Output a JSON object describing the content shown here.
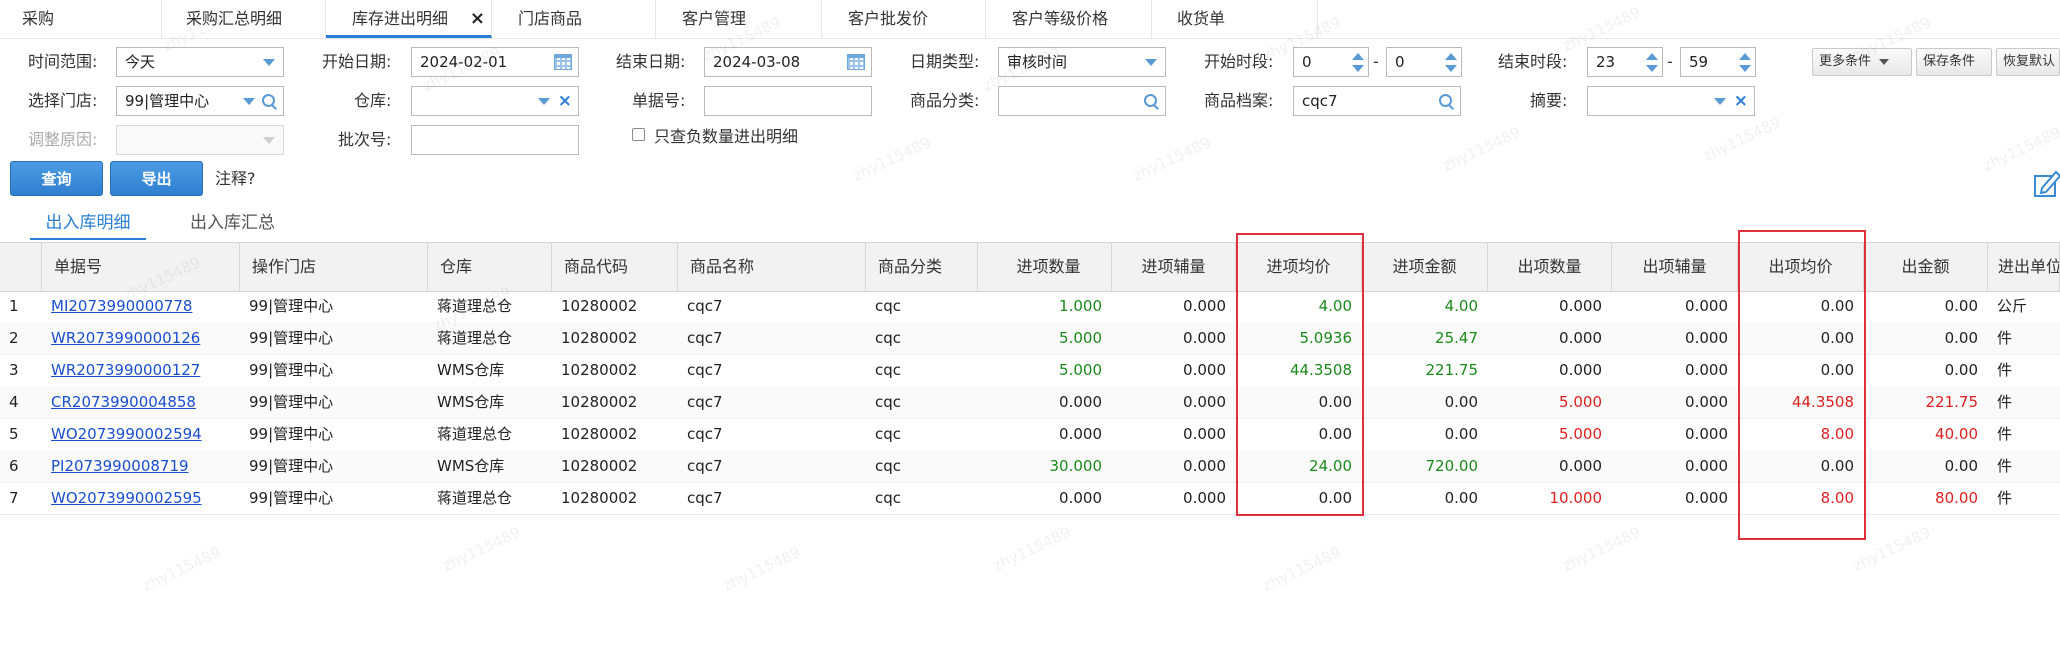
{
  "tabs": [
    {
      "label": "采购",
      "active": false,
      "closable": false
    },
    {
      "label": "采购汇总明细",
      "active": false,
      "closable": false
    },
    {
      "label": "库存进出明细",
      "active": true,
      "closable": true
    },
    {
      "label": "门店商品",
      "active": false,
      "closable": false
    },
    {
      "label": "客户管理",
      "active": false,
      "closable": false
    },
    {
      "label": "客户批发价",
      "active": false,
      "closable": false
    },
    {
      "label": "客户等级价格",
      "active": false,
      "closable": false
    },
    {
      "label": "收货单",
      "active": false,
      "closable": false
    }
  ],
  "close_glyph": "×",
  "filters": {
    "time_range": {
      "label": "时间范围:",
      "value": "今天"
    },
    "start_date": {
      "label": "开始日期:",
      "value": "2024-02-01"
    },
    "end_date": {
      "label": "结束日期:",
      "value": "2024-03-08"
    },
    "date_type": {
      "label": "日期类型:",
      "value": "审核时间"
    },
    "start_period": {
      "label": "开始时段:",
      "hour": "0",
      "minute": "0"
    },
    "end_period": {
      "label": "结束时段:",
      "hour": "23",
      "minute": "59"
    },
    "store": {
      "label": "选择门店:",
      "value": "99|管理中心"
    },
    "warehouse": {
      "label": "仓库:",
      "value": ""
    },
    "doc_no": {
      "label": "单据号:",
      "value": ""
    },
    "category": {
      "label": "商品分类:",
      "value": ""
    },
    "product_file": {
      "label": "商品档案:",
      "value": "cqc7"
    },
    "summary": {
      "label": "摘要:",
      "value": ""
    },
    "adjust_reason": {
      "label": "调整原因:",
      "value": ""
    },
    "batch_no": {
      "label": "批次号:",
      "value": ""
    },
    "negative_only": {
      "label": "只查负数量进出明细",
      "checked": false
    },
    "dash": "-"
  },
  "toolbar": {
    "more_conditions": "更多条件",
    "save_conditions": "保存条件",
    "restore_default": "恢复默认",
    "query": "查询",
    "export": "导出",
    "note": "注释?"
  },
  "subtabs": [
    {
      "label": "出入库明细",
      "active": true
    },
    {
      "label": "出入库汇总",
      "active": false
    }
  ],
  "grid": {
    "columns": [
      "单据号",
      "操作门店",
      "仓库",
      "商品代码",
      "商品名称",
      "商品分类",
      "进项数量",
      "进项辅量",
      "进项均价",
      "进项金额",
      "出项数量",
      "出项辅量",
      "出项均价",
      "出金额",
      "进出单位"
    ],
    "rows": [
      {
        "no": "1",
        "doc": "MI2073990000778",
        "store": "99|管理中心",
        "wh": "蒋道理总仓",
        "code": "10280002",
        "name": "cqc7",
        "cat": "cqc",
        "in_qty": "1.000",
        "in_aux": "0.000",
        "in_avg": "4.00",
        "in_amt": "4.00",
        "out_qty": "0.000",
        "out_aux": "0.000",
        "out_avg": "0.00",
        "out_amt": "0.00",
        "unit": "公斤"
      },
      {
        "no": "2",
        "doc": "WR2073990000126",
        "store": "99|管理中心",
        "wh": "蒋道理总仓",
        "code": "10280002",
        "name": "cqc7",
        "cat": "cqc",
        "in_qty": "5.000",
        "in_aux": "0.000",
        "in_avg": "5.0936",
        "in_amt": "25.47",
        "out_qty": "0.000",
        "out_aux": "0.000",
        "out_avg": "0.00",
        "out_amt": "0.00",
        "unit": "件"
      },
      {
        "no": "3",
        "doc": "WR2073990000127",
        "store": "99|管理中心",
        "wh": "WMS仓库",
        "code": "10280002",
        "name": "cqc7",
        "cat": "cqc",
        "in_qty": "5.000",
        "in_aux": "0.000",
        "in_avg": "44.3508",
        "in_amt": "221.75",
        "out_qty": "0.000",
        "out_aux": "0.000",
        "out_avg": "0.00",
        "out_amt": "0.00",
        "unit": "件"
      },
      {
        "no": "4",
        "doc": "CR2073990004858",
        "store": "99|管理中心",
        "wh": "WMS仓库",
        "code": "10280002",
        "name": "cqc7",
        "cat": "cqc",
        "in_qty": "0.000",
        "in_aux": "0.000",
        "in_avg": "0.00",
        "in_amt": "0.00",
        "out_qty": "5.000",
        "out_aux": "0.000",
        "out_avg": "44.3508",
        "out_amt": "221.75",
        "unit": "件"
      },
      {
        "no": "5",
        "doc": "WO2073990002594",
        "store": "99|管理中心",
        "wh": "蒋道理总仓",
        "code": "10280002",
        "name": "cqc7",
        "cat": "cqc",
        "in_qty": "0.000",
        "in_aux": "0.000",
        "in_avg": "0.00",
        "in_amt": "0.00",
        "out_qty": "5.000",
        "out_aux": "0.000",
        "out_avg": "8.00",
        "out_amt": "40.00",
        "unit": "件"
      },
      {
        "no": "6",
        "doc": "PI2073990008719",
        "store": "99|管理中心",
        "wh": "WMS仓库",
        "code": "10280002",
        "name": "cqc7",
        "cat": "cqc",
        "in_qty": "30.000",
        "in_aux": "0.000",
        "in_avg": "24.00",
        "in_amt": "720.00",
        "out_qty": "0.000",
        "out_aux": "0.000",
        "out_avg": "0.00",
        "out_amt": "0.00",
        "unit": "件"
      },
      {
        "no": "7",
        "doc": "WO2073990002595",
        "store": "99|管理中心",
        "wh": "蒋道理总仓",
        "code": "10280002",
        "name": "cqc7",
        "cat": "cqc",
        "in_qty": "0.000",
        "in_aux": "0.000",
        "in_avg": "0.00",
        "in_amt": "0.00",
        "out_qty": "10.000",
        "out_aux": "0.000",
        "out_avg": "8.00",
        "out_amt": "80.00",
        "unit": "件"
      }
    ]
  },
  "watermark": "zhy115489",
  "colors": {
    "accent": "#2a7fd4",
    "in_green": "#1a8a1a",
    "out_red": "#e02020",
    "highlight": "#e0303a",
    "link": "#1a4fd1"
  },
  "icons": [
    "close-icon",
    "dropdown-arrow-icon",
    "calendar-icon",
    "search-icon",
    "clear-x-icon",
    "spinner-up-icon",
    "spinner-down-icon",
    "edit-icon"
  ]
}
